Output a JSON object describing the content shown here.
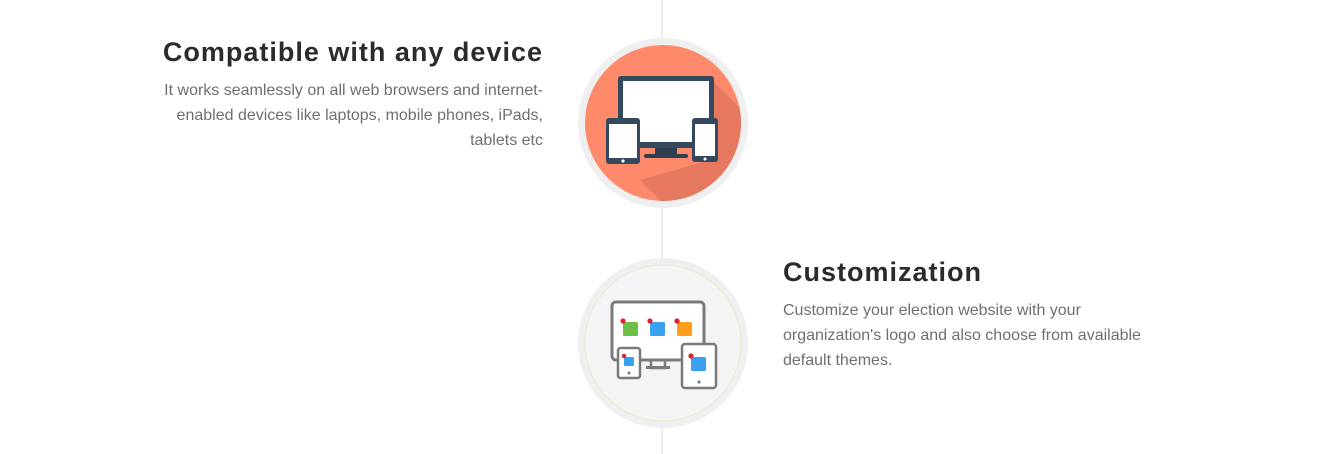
{
  "features": [
    {
      "title": "Compatible with any device",
      "description": "It works seamlessly on all web browsers and internet-enabled devices like laptops, mobile phones, iPads, tablets etc",
      "icon": "multi-device-icon",
      "accent": "#fe8a6b"
    },
    {
      "title": "Customization",
      "description": "Customize your election website with your organization's logo and also choose from available default themes.",
      "icon": "customization-devices-icon",
      "accent": "#f4f4f4"
    }
  ],
  "colors": {
    "title": "#2b2b2b",
    "text": "#6f6f6f",
    "timeline": "#ececec",
    "orange": "#fe8a6b",
    "green": "#6cc04a",
    "blue": "#3aa0f0",
    "amber": "#ff9f1c",
    "red_dot": "#e0202a"
  }
}
